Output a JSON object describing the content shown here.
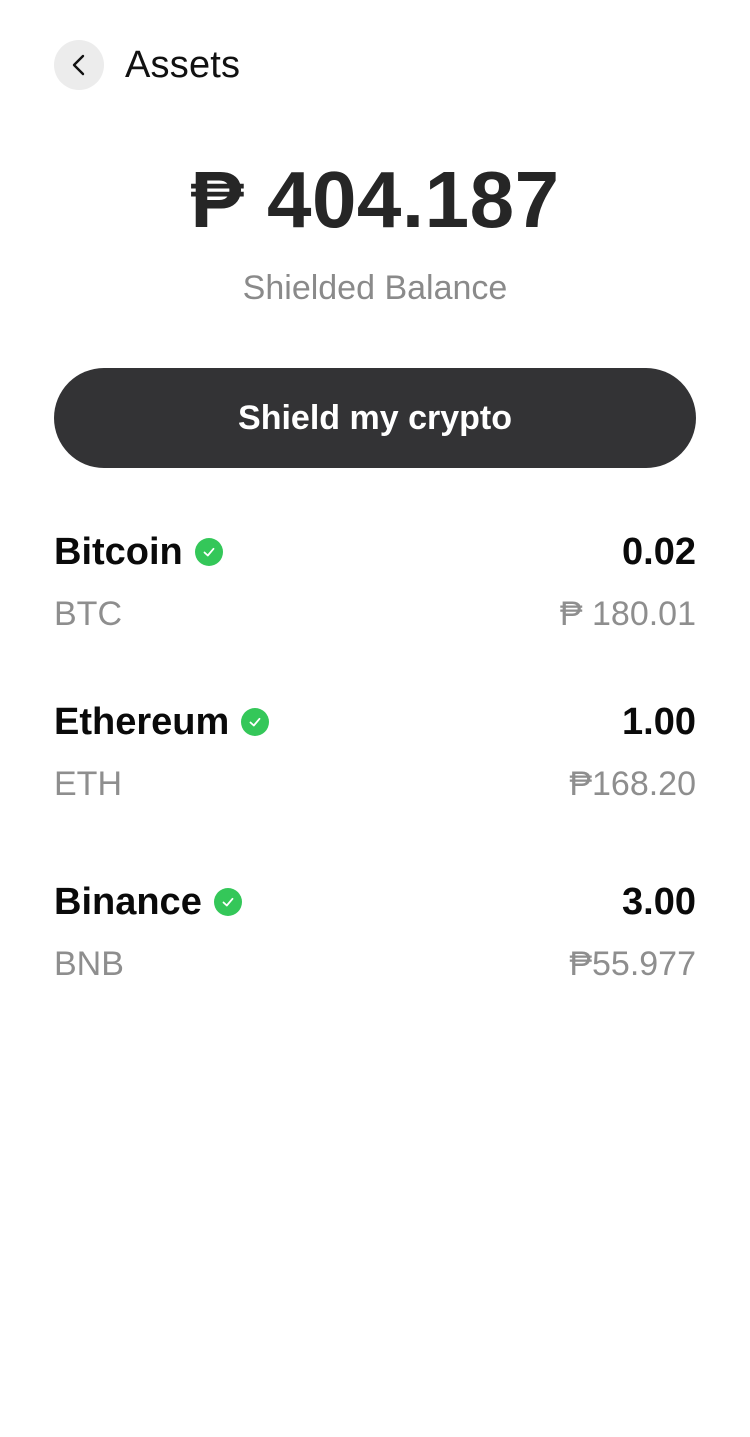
{
  "header": {
    "title": "Assets",
    "back_icon": "chevron-left-icon"
  },
  "balance": {
    "amount": "₱ 404.187",
    "label": "Shielded Balance"
  },
  "actions": {
    "shield_label": "Shield my crypto"
  },
  "colors": {
    "button_bg": "#333335",
    "verified": "#34c759",
    "muted_text": "#8e8e8e"
  },
  "assets": [
    {
      "name": "Bitcoin",
      "symbol": "BTC",
      "amount": "0.02",
      "value": "₱ 180.01",
      "verified": true
    },
    {
      "name": "Ethereum",
      "symbol": "ETH",
      "amount": "1.00",
      "value": "₱168.20",
      "verified": true
    },
    {
      "name": "Binance",
      "symbol": "BNB",
      "amount": "3.00",
      "value": "₱55.977",
      "verified": true
    }
  ]
}
